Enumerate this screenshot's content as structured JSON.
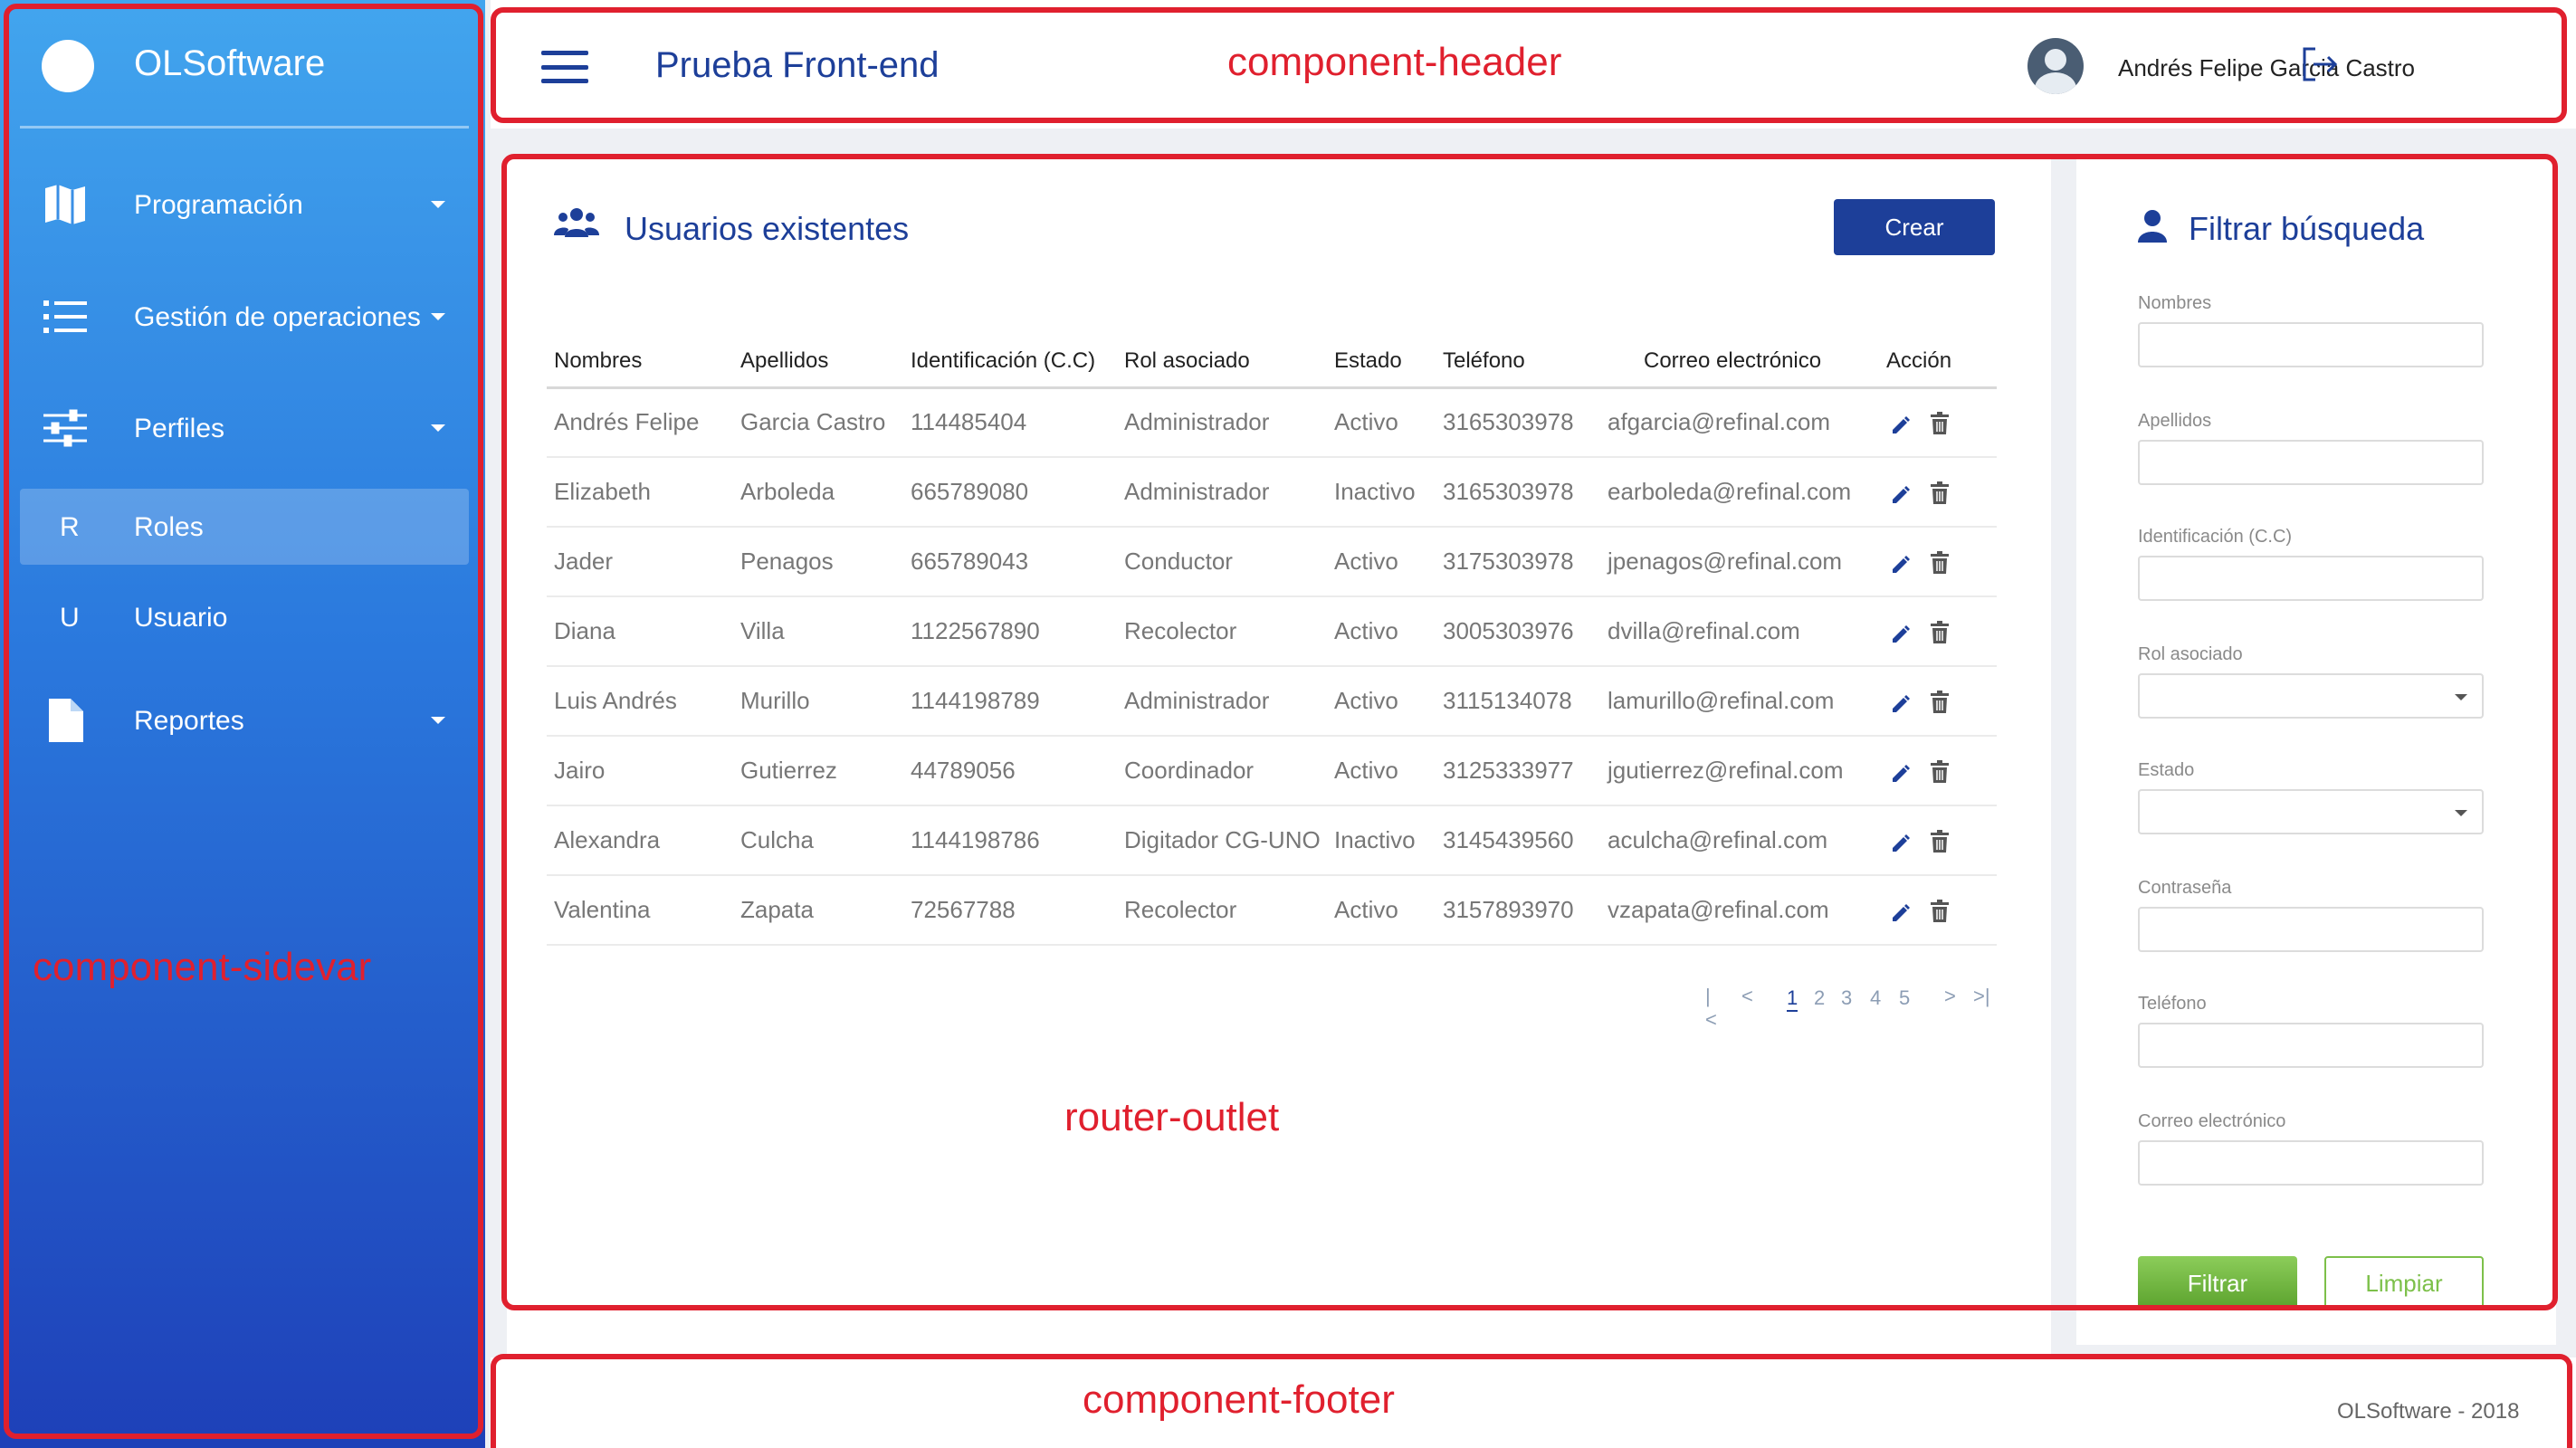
{
  "sidebar": {
    "brand": "OLSoftware",
    "items": [
      {
        "label": "Programación",
        "icon": "map-icon"
      },
      {
        "label": "Gestión de operaciones",
        "icon": "list-icon"
      },
      {
        "label": "Perfiles",
        "icon": "sliders-icon"
      },
      {
        "label": "Roles",
        "letter": "R",
        "active": true
      },
      {
        "label": "Usuario",
        "letter": "U"
      },
      {
        "label": "Reportes",
        "icon": "document-icon"
      }
    ]
  },
  "header": {
    "title": "Prueba Front-end",
    "user_name": "Andrés Felipe Garcia Castro"
  },
  "main": {
    "title": "Usuarios existentes",
    "create_label": "Crear",
    "columns": [
      "Nombres",
      "Apellidos",
      "Identificación (C.C)",
      "Rol asociado",
      "Estado",
      "Teléfono",
      "Correo electrónico",
      "Acción"
    ],
    "rows": [
      [
        "Andrés Felipe",
        "Garcia Castro",
        "114485404",
        "Administrador",
        "Activo",
        "3165303978",
        "afgarcia@refinal.com"
      ],
      [
        "Elizabeth",
        "Arboleda",
        "665789080",
        "Administrador",
        "Inactivo",
        "3165303978",
        "earboleda@refinal.com"
      ],
      [
        "Jader",
        "Penagos",
        "665789043",
        "Conductor",
        "Activo",
        "3175303978",
        "jpenagos@refinal.com"
      ],
      [
        "Diana",
        "Villa",
        "1122567890",
        "Recolector",
        "Activo",
        "3005303976",
        "dvilla@refinal.com"
      ],
      [
        "Luis Andrés",
        "Murillo",
        "1144198789",
        "Administrador",
        "Activo",
        "3115134078",
        "lamurillo@refinal.com"
      ],
      [
        "Jairo",
        "Gutierrez",
        "44789056",
        "Coordinador",
        "Activo",
        "3125333977",
        "jgutierrez@refinal.com"
      ],
      [
        "Alexandra",
        "Culcha",
        "1144198786",
        "Digitador CG-UNO",
        "Inactivo",
        "3145439560",
        "aculcha@refinal.com"
      ],
      [
        "Valentina",
        "Zapata",
        "72567788",
        "Recolector",
        "Activo",
        "3157893970",
        "vzapata@refinal.com"
      ]
    ],
    "pagination": {
      "first": "|<",
      "prev": "<",
      "pages": [
        "1",
        "2",
        "3",
        "4",
        "5"
      ],
      "current": "1",
      "next": ">",
      "last": ">|"
    }
  },
  "filter": {
    "title": "Filtrar búsqueda",
    "fields": [
      {
        "label": "Nombres",
        "type": "text",
        "value": ""
      },
      {
        "label": "Apellidos",
        "type": "text",
        "value": ""
      },
      {
        "label": "Identificación (C.C)",
        "type": "text",
        "value": ""
      },
      {
        "label": "Rol asociado",
        "type": "select",
        "value": ""
      },
      {
        "label": "Estado",
        "type": "select",
        "value": ""
      },
      {
        "label": "Contraseña",
        "type": "text",
        "value": ""
      },
      {
        "label": "Teléfono",
        "type": "text",
        "value": ""
      },
      {
        "label": "Correo electrónico",
        "type": "text",
        "value": ""
      }
    ],
    "filter_label": "Filtrar",
    "clear_label": "Limpiar"
  },
  "footer": {
    "text": "OLSoftware - 2018"
  },
  "annotations": {
    "sidebar": "component-sidevar",
    "header": "component-header",
    "router": "router-outlet",
    "footer": "component-footer"
  },
  "colors": {
    "primary": "#1d3f99",
    "sidebar_top": "#42a5ee",
    "sidebar_bottom": "#1e40b8",
    "annotation": "#e0202e",
    "success": "#6ab33a"
  }
}
